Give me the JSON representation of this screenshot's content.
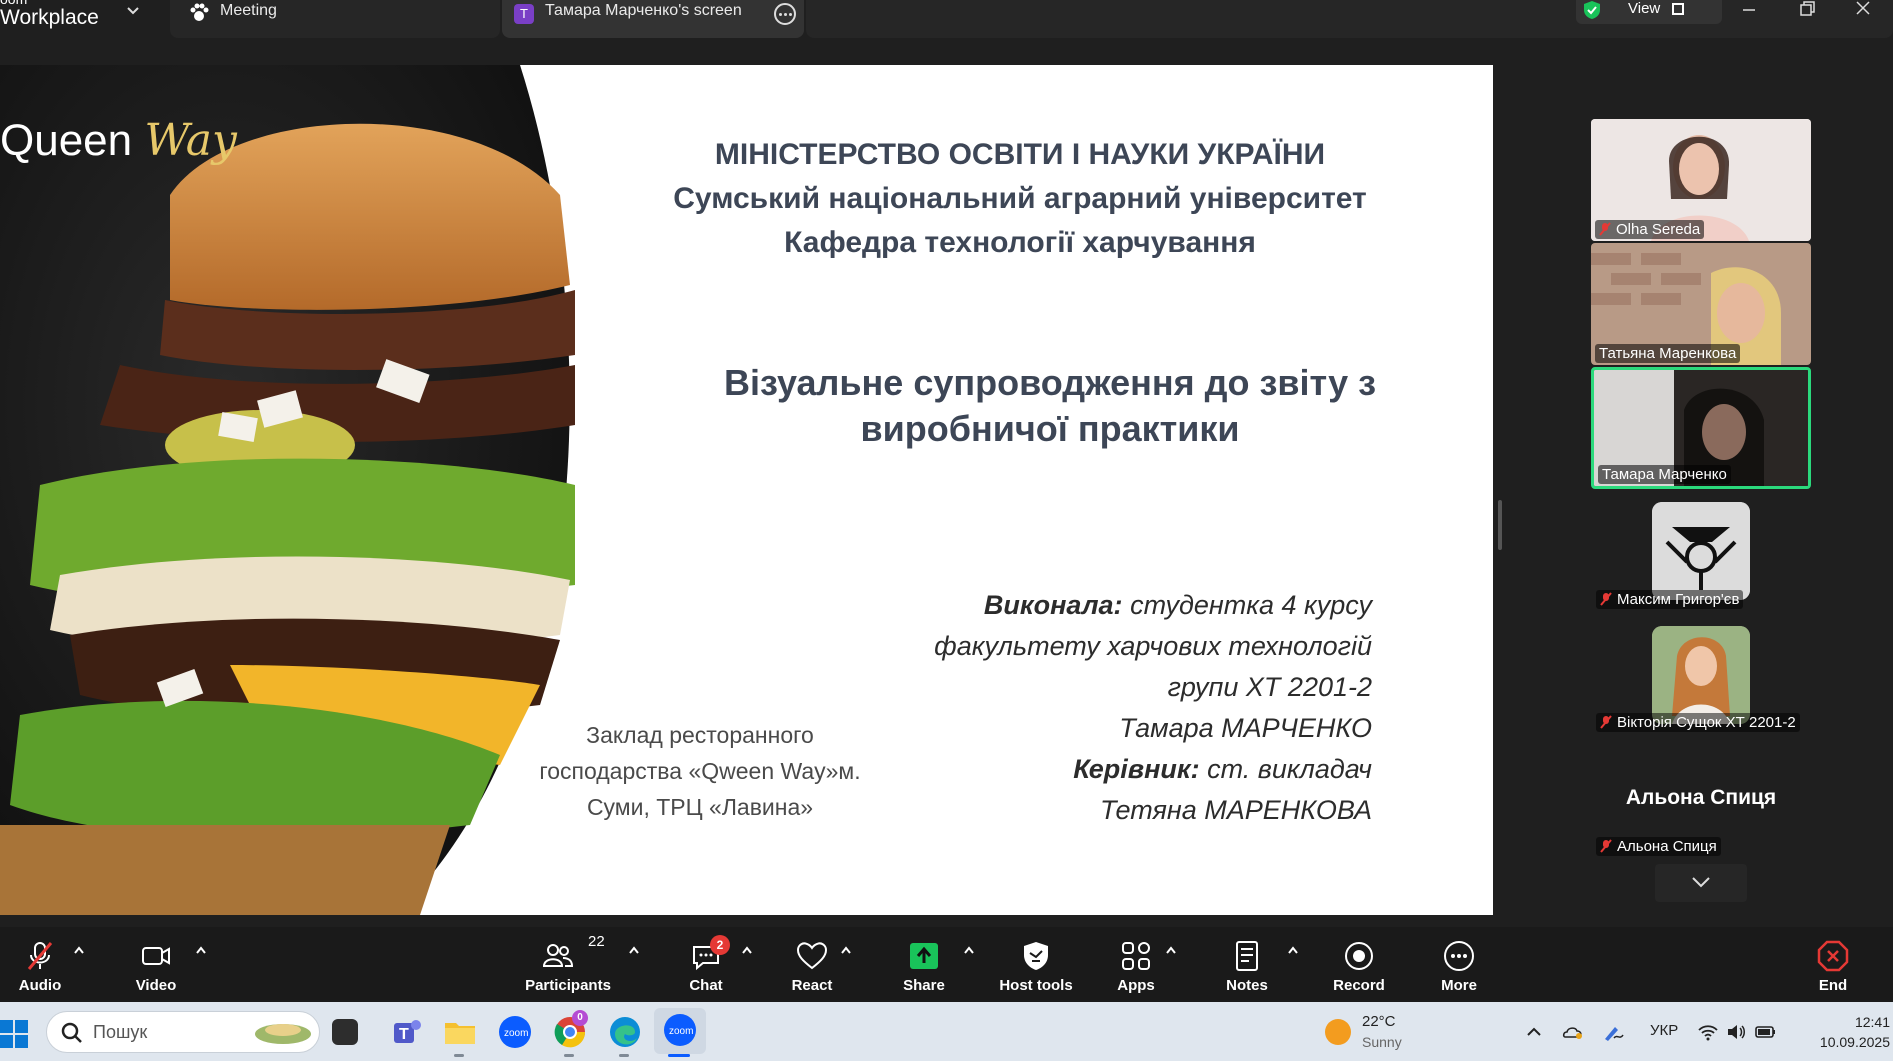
{
  "window": {
    "app_line1": "oom",
    "app_line2": "Workplace",
    "tabs": [
      {
        "label": "Meeting"
      },
      {
        "label": "Тамара Марченко's screen",
        "badge": "T"
      }
    ],
    "view_label": "View"
  },
  "slide": {
    "logo_text": "Queen",
    "logo_script": "Way",
    "header": [
      "МІНІСТЕРСТВО ОСВІТИ І НАУКИ УКРАЇНИ",
      "Сумський національний аграрний університет",
      "Кафедра технології харчування"
    ],
    "title_line1": "Візуальне супроводження до звіту з",
    "title_line2": "виробничої практики",
    "place": [
      "Заклад ресторанного",
      "господарства «Qween Way»м.",
      "Суми, ТРЦ «Лавина»"
    ],
    "performer_label": "Виконала:",
    "performer_text": " студентка 4 курсу",
    "faculty": "факультету харчових технологій",
    "group": "групи ХТ 2201-2",
    "student": "Тамара МАРЧЕНКО",
    "supervisor_label": "Керівник:",
    "supervisor_text": " ст. викладач",
    "supervisor": "Тетяна МАРЕНКОВА"
  },
  "gallery": {
    "participants": [
      {
        "name": "Olha Sereda",
        "muted": true
      },
      {
        "name": "Татьяна Маренкова",
        "muted": false
      },
      {
        "name": "Тамара Марченко",
        "muted": false,
        "active": true
      },
      {
        "name": "Максим Григор'єв",
        "muted": true
      },
      {
        "name": "Вікторія Сущок ХТ 2201-2",
        "muted": true
      },
      {
        "name": "Альона Спиця",
        "muted": true
      }
    ],
    "big_name": "Альона Спиця"
  },
  "toolbar": {
    "audio": "Audio",
    "video": "Video",
    "participants": "Participants",
    "participants_count": "22",
    "chat": "Chat",
    "chat_badge": "2",
    "react": "React",
    "share": "Share",
    "host_tools": "Host tools",
    "apps": "Apps",
    "notes": "Notes",
    "record": "Record",
    "more": "More",
    "end": "End"
  },
  "taskbar": {
    "search_placeholder": "Пошук",
    "weather_temp": "22°C",
    "weather_desc": "Sunny",
    "lang": "УКР",
    "time": "12:41",
    "date": "10.09.2025",
    "chrome_badge": "0"
  },
  "colors": {
    "active_speaker": "#2bd97c",
    "share_green": "#19c35a",
    "end_red": "#e53935",
    "slide_text": "#3d4656"
  }
}
